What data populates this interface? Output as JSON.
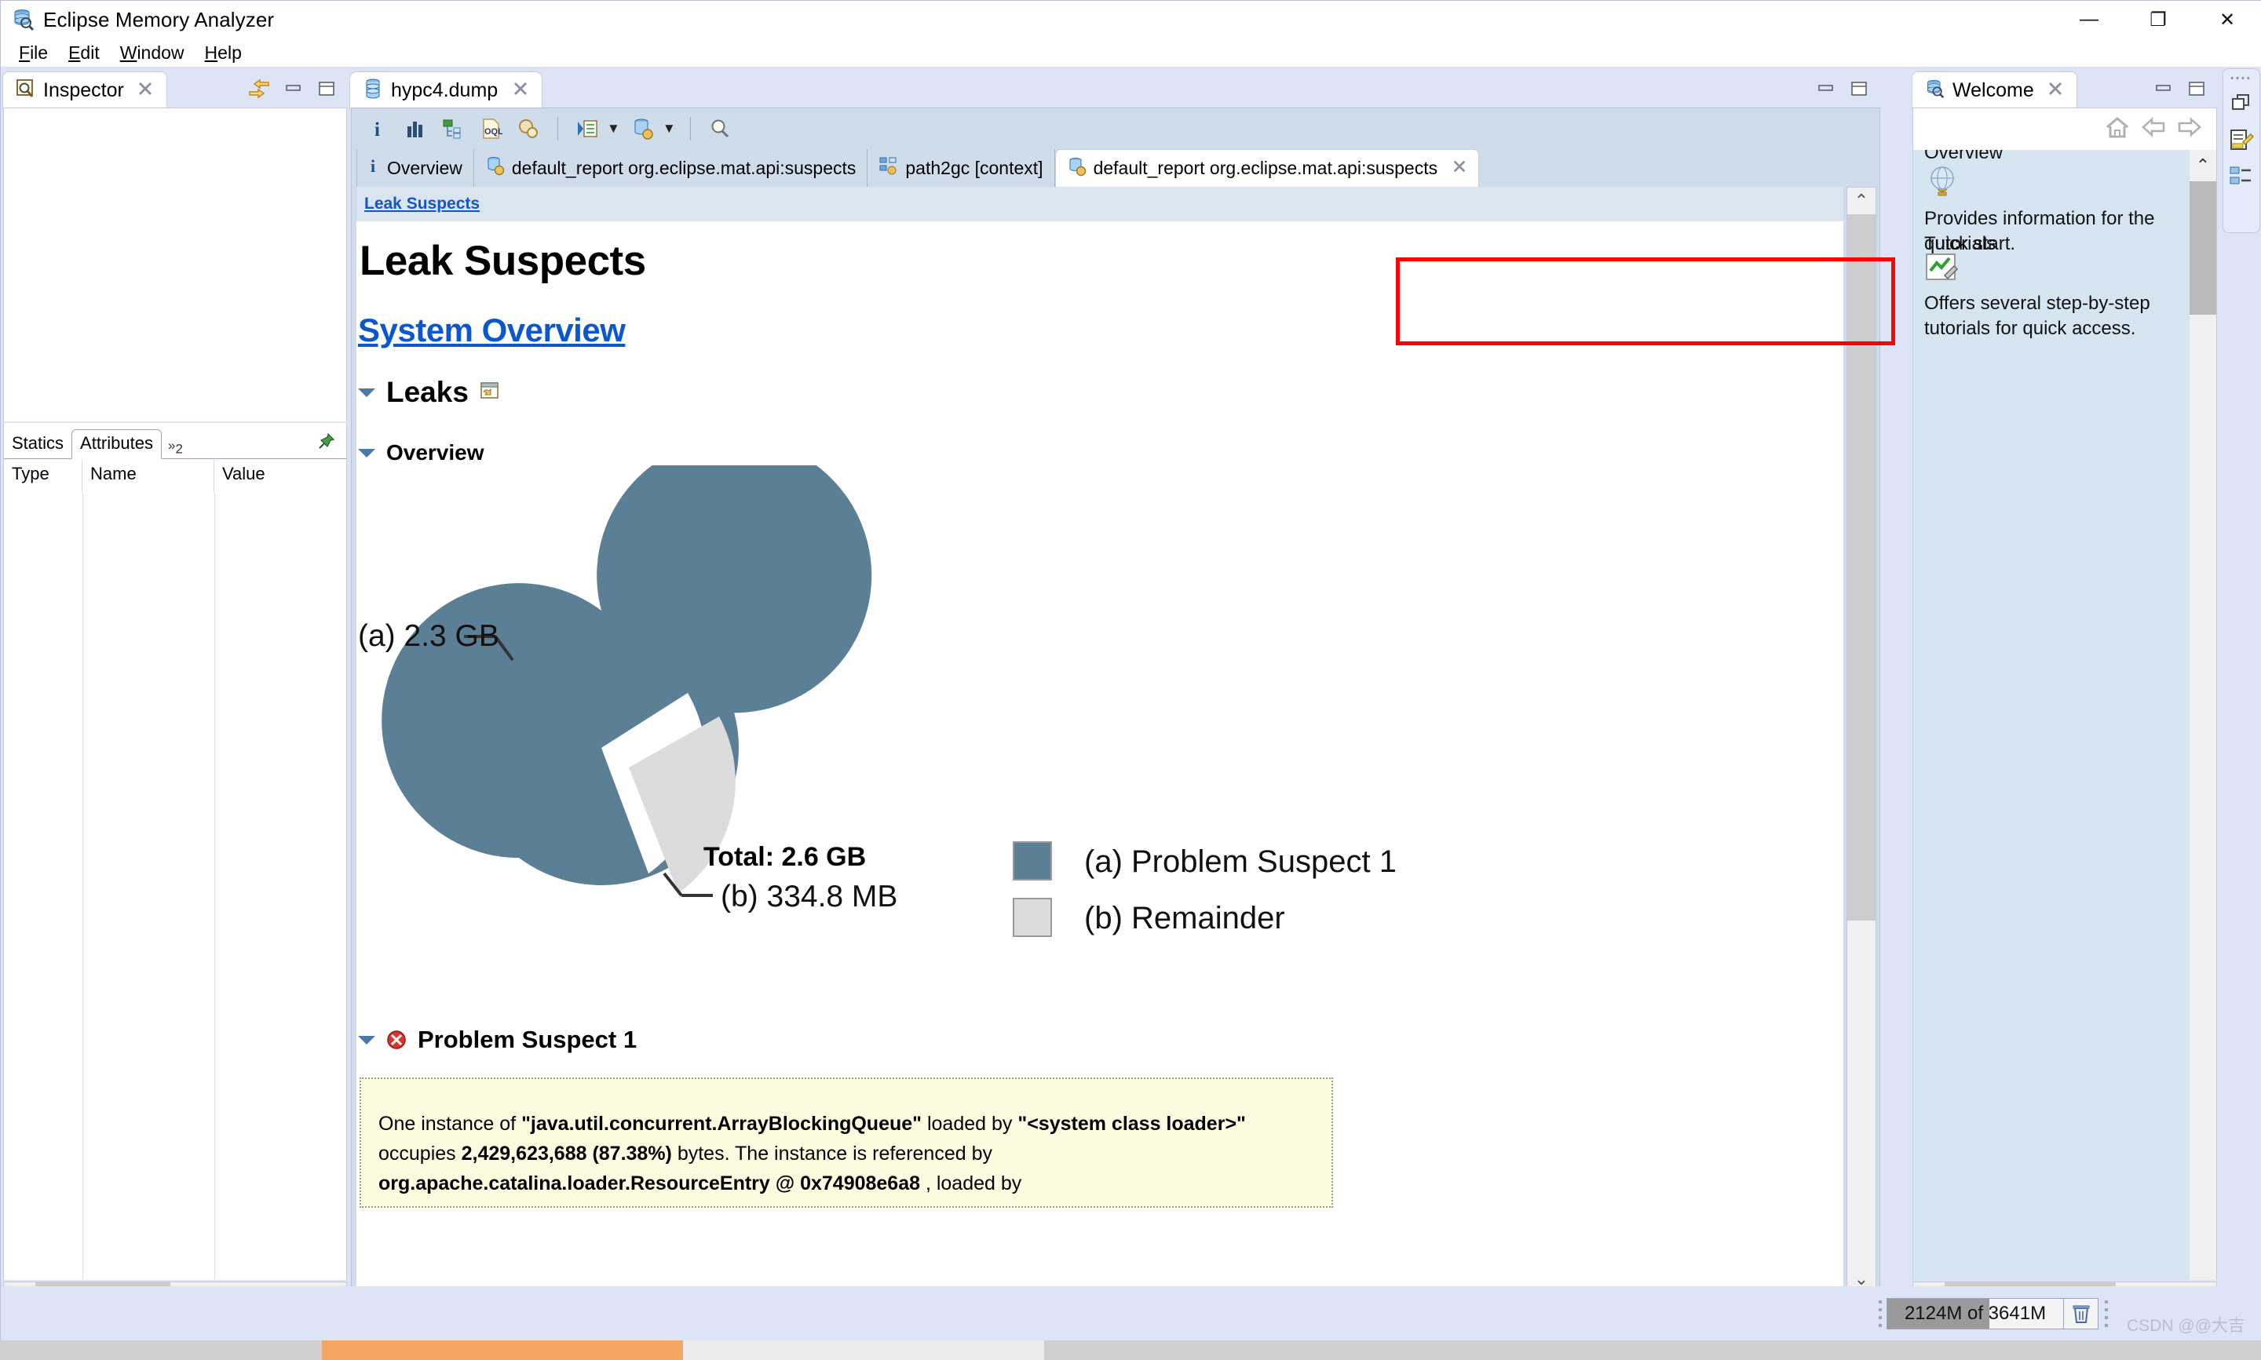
{
  "window": {
    "title": "Eclipse Memory Analyzer",
    "app_icon": "memory-analyzer-icon",
    "minimize": "—",
    "maximize": "❐",
    "close": "✕"
  },
  "menu": {
    "items": [
      {
        "label": "File",
        "mnemonic": "F"
      },
      {
        "label": "Edit",
        "mnemonic": "E"
      },
      {
        "label": "Window",
        "mnemonic": "W"
      },
      {
        "label": "Help",
        "mnemonic": "H"
      }
    ]
  },
  "inspector": {
    "tab_label": "Inspector",
    "tab_icon": "inspector-icon",
    "close_glyph": "✖",
    "toolbar_icons": [
      "link-with-editor-icon",
      "minimize-icon",
      "maximize-icon"
    ],
    "tabs": [
      {
        "label": "Statics",
        "active": false
      },
      {
        "label": "Attributes",
        "active": true
      }
    ],
    "overflow_label": "»",
    "overflow_count": "2",
    "pin_icon": "pin-icon",
    "columns": [
      "Type",
      "Name",
      "Value"
    ],
    "rows": []
  },
  "editor": {
    "tab_label": "hypc4.dump",
    "tab_icon": "heap-dump-icon",
    "close_glyph": "✖",
    "minimize_glyph": "▃",
    "maximize_glyph": "❐",
    "toolbar": [
      {
        "name": "info-icon",
        "glyph": "i"
      },
      {
        "name": "histogram-icon",
        "glyph": ""
      },
      {
        "name": "dominator-tree-icon",
        "glyph": ""
      },
      {
        "name": "oql-icon",
        "glyph": "OQL"
      },
      {
        "name": "run-report-icon",
        "glyph": ""
      },
      {
        "name": "query-browser-icon",
        "glyph": ""
      },
      {
        "name": "open-heap-dump-icon",
        "glyph": ""
      },
      {
        "name": "search-icon",
        "glyph": ""
      }
    ],
    "report_tabs": [
      {
        "label": "Overview",
        "icon": "info-icon",
        "active": false,
        "closable": false
      },
      {
        "label": "default_report  org.eclipse.mat.api:suspects",
        "icon": "report-icon",
        "active": false,
        "closable": false
      },
      {
        "label": "path2gc  [context]",
        "icon": "path2gc-icon",
        "active": false,
        "closable": false
      },
      {
        "label": "default_report  org.eclipse.mat.api:suspects",
        "icon": "report-icon",
        "active": true,
        "closable": true
      }
    ],
    "highlight_color": "#ff0000"
  },
  "report": {
    "breadcrumb": "Leak Suspects",
    "title": "Leak Suspects",
    "system_overview_link": "System Overview",
    "leaks_heading": "Leaks",
    "leaks_icon": "open-in-new-window-icon",
    "overview_heading": "Overview",
    "total_label": "Total: 2.6 GB",
    "suspect_heading": "Problem Suspect 1",
    "suspect_icon": "error-icon",
    "description": {
      "segments": [
        {
          "text": "One instance of ",
          "bold": false
        },
        {
          "text": "\"java.util.concurrent.ArrayBlockingQueue\"",
          "bold": true
        },
        {
          "text": " loaded by ",
          "bold": false
        },
        {
          "text": "\"<system class loader>\"",
          "bold": true
        },
        {
          "text": " occupies ",
          "bold": false
        },
        {
          "text": "2,429,623,688 (87.38%)",
          "bold": true
        },
        {
          "text": " bytes. The instance is referenced by ",
          "bold": false
        },
        {
          "text": "org.apache.catalina.loader.ResourceEntry @ 0x74908e6a8",
          "bold": true
        },
        {
          "text": " , loaded by",
          "bold": false
        }
      ]
    }
  },
  "chart_data": {
    "type": "pie",
    "title": "",
    "total_label": "Total: 2.6 GB",
    "legend_position": "right",
    "slices": [
      {
        "key": "(a)",
        "label": "Problem Suspect 1",
        "value_label": "2.3 GB",
        "value_bytes": 2429623688,
        "percent": 87.38,
        "color": "#5b7f95",
        "exploded": false
      },
      {
        "key": "(b)",
        "label": "Remainder",
        "value_label": "334.8 MB",
        "value_bytes": 351048499,
        "percent": 12.62,
        "color": "#dcdcdc",
        "exploded": true
      }
    ],
    "legend": [
      {
        "key": "(a)",
        "label": "Problem Suspect 1",
        "color": "#5b7f95"
      },
      {
        "key": "(b)",
        "label": "Remainder",
        "color": "#dcdcdc"
      }
    ],
    "callouts": [
      {
        "key": "(a)",
        "text": "(a)  2.3 GB",
        "side": "left"
      },
      {
        "key": "(b)",
        "text": "(b)  334.8 MB",
        "side": "right"
      }
    ]
  },
  "welcome": {
    "tab_label": "Welcome",
    "tab_icon": "memory-analyzer-icon",
    "close_glyph": "✖",
    "minimize_glyph": "▃",
    "maximize_glyph": "❐",
    "nav_icons": [
      "home-icon",
      "back-arrow-icon",
      "forward-arrow-icon"
    ],
    "sections": [
      {
        "title": "Overview",
        "icon": "globe-icon",
        "text": "Provides information for the quick start."
      },
      {
        "title": "Tutorials",
        "icon": "tutorials-icon",
        "text": "Offers several step-by-step tutorials for quick access."
      }
    ]
  },
  "fastbar": {
    "icons": [
      "restore-perspective-icon",
      "edit-report-icon",
      "dominator-tree-icon"
    ]
  },
  "statusbar": {
    "heap_text": "2124M of 3641M",
    "heap_used_mb": 2124,
    "heap_max_mb": 3641,
    "heap_percent": 58,
    "trash_icon": "trash-icon",
    "watermark": "CSDN @@大吉"
  },
  "scrollbars": {
    "left_arrow": "‹",
    "right_arrow": "›",
    "up_arrow": "⌃",
    "down_arrow": "⌄"
  }
}
